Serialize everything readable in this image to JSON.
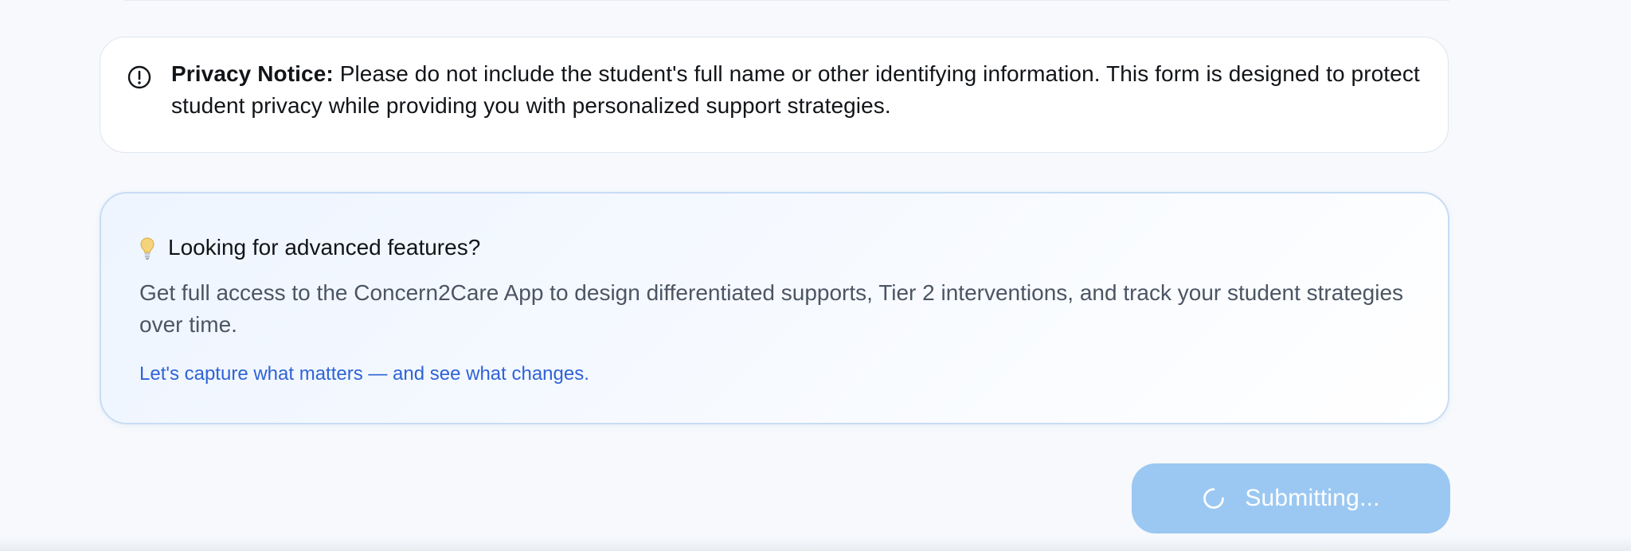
{
  "privacy_notice": {
    "title": "Privacy Notice:",
    "body": " Please do not include the student's full name or other identifying information. This form is designed to protect student privacy while providing you with personalized support strategies.",
    "icon": "info-circle-icon"
  },
  "feature_callout": {
    "icon": "lightbulb-icon",
    "title": "Looking for advanced features?",
    "body": "Get full access to the Concern2Care App to design differentiated supports, Tier 2 interventions, and track your student strategies over time.",
    "link_label": "Let's capture what matters — and see what changes."
  },
  "actions": {
    "submit_label": "Submitting...",
    "submit_icon": "spinner-icon"
  },
  "colors": {
    "page_background": "#f7f9fc",
    "feature_border": "#c8dcf4",
    "feature_link": "#2f63d6",
    "submit_button": "#9bc8f2"
  }
}
